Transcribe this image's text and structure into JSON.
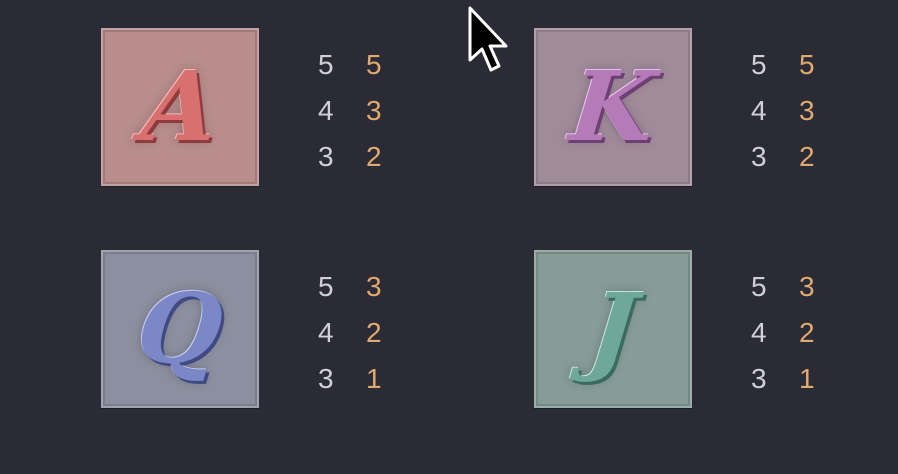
{
  "symbols": [
    {
      "letter": "A",
      "color": "#d8706f",
      "tile_color": "#b88d8c",
      "payouts": [
        {
          "count": "5",
          "value": "5"
        },
        {
          "count": "4",
          "value": "3"
        },
        {
          "count": "3",
          "value": "2"
        }
      ]
    },
    {
      "letter": "K",
      "color": "#b57ab8",
      "tile_color": "#a08b9a",
      "payouts": [
        {
          "count": "5",
          "value": "5"
        },
        {
          "count": "4",
          "value": "3"
        },
        {
          "count": "3",
          "value": "2"
        }
      ]
    },
    {
      "letter": "Q",
      "color": "#7b87c6",
      "tile_color": "#8c8f9f",
      "payouts": [
        {
          "count": "5",
          "value": "3"
        },
        {
          "count": "4",
          "value": "2"
        },
        {
          "count": "3",
          "value": "1"
        }
      ]
    },
    {
      "letter": "J",
      "color": "#6fa89b",
      "tile_color": "#879b97",
      "payouts": [
        {
          "count": "5",
          "value": "3"
        },
        {
          "count": "4",
          "value": "2"
        },
        {
          "count": "3",
          "value": "1"
        }
      ]
    }
  ],
  "cursor": {
    "icon": "mouse-pointer-icon"
  },
  "colors": {
    "background": "#2b2b36",
    "count_text": "#d0d0d6",
    "value_text": "#e0a970"
  }
}
